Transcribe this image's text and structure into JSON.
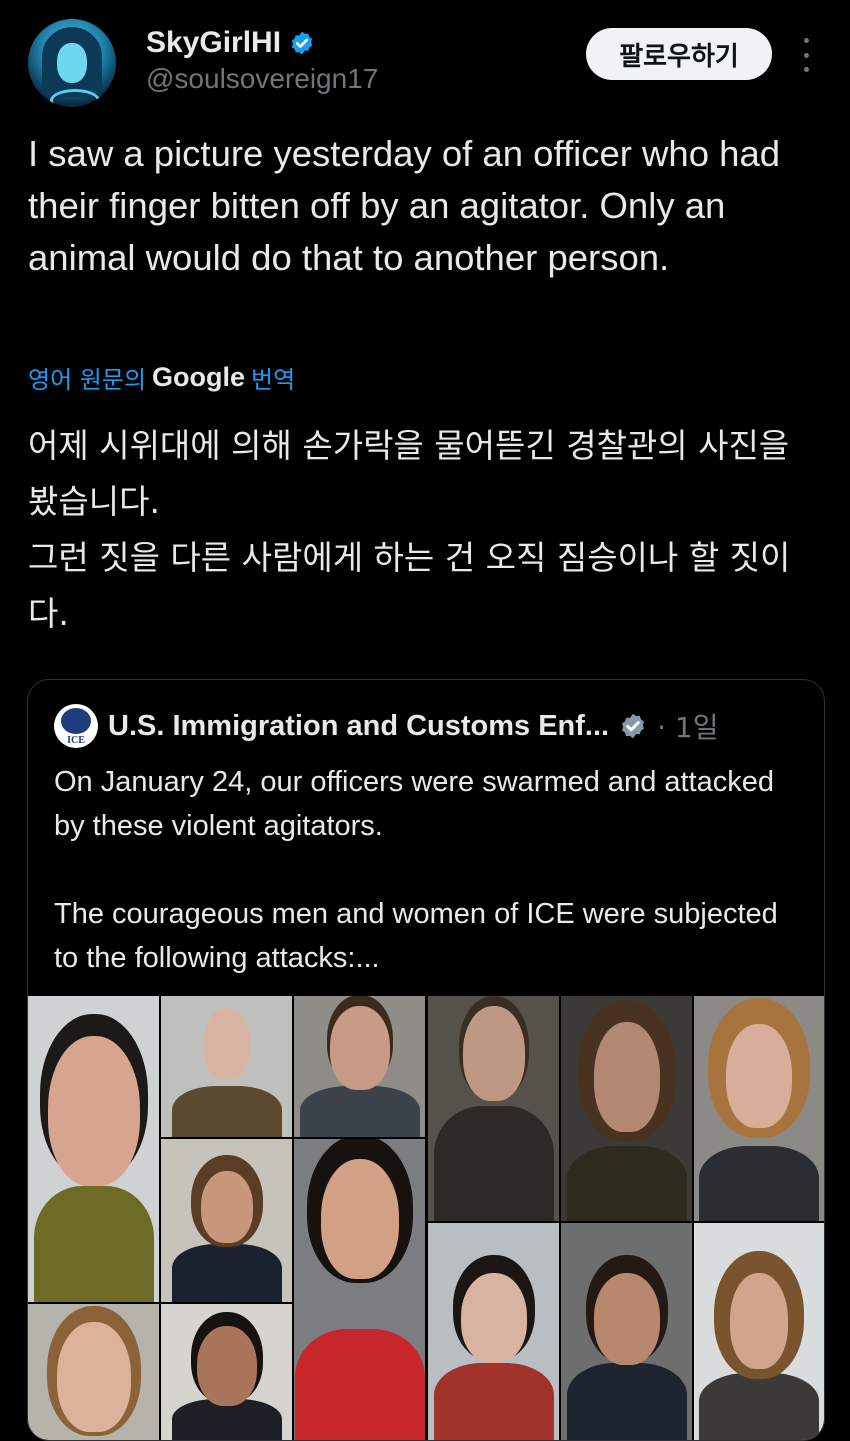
{
  "user": {
    "name": "SkyGirlHI",
    "handle": "@soulsovereign17",
    "verified_color": "#1d9bf0"
  },
  "actions": {
    "follow_label": "팔로우하기",
    "more_icon": "more-vertical-icon"
  },
  "tweet": {
    "text": "I saw a picture yesterday of an officer who had their finger bitten off by an agitator. Only an animal would do that to another person."
  },
  "translation": {
    "prefix": "영어 원문의",
    "brand": "Google",
    "suffix": "번역",
    "lines": [
      "어제 시위대에 의해 손가락을 물어뜯긴 경찰관의 사진을 봤습니다.",
      "그런 짓을 다른 사람에게 하는 건 오직 짐승이나 할 짓이다."
    ]
  },
  "quote": {
    "name": "U.S. Immigration and Customs Enf...",
    "logo_label": "ICE",
    "time": "· 1일",
    "paragraph1": "On January 24, our officers were swarmed and attacked by these violent agitators.",
    "paragraph2": "The courageous men and women of ICE were subjected to the following attacks:..."
  },
  "colors": {
    "background": "#000000",
    "text": "#e7e9ea",
    "muted": "#71767b",
    "link": "#1d9bf0",
    "border": "#2f3336"
  }
}
